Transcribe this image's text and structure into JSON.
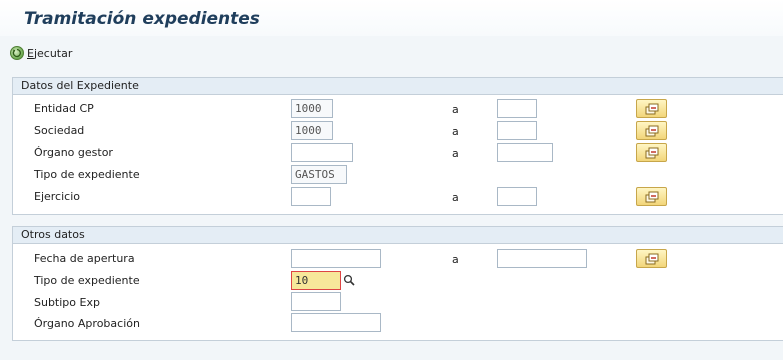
{
  "header": {
    "title": "Tramitación expedientes"
  },
  "toolbar": {
    "execute_label_first": "E",
    "execute_label_rest": "jecutar"
  },
  "group1": {
    "title": "Datos del Expediente",
    "rows": [
      {
        "label": "Entidad CP",
        "low_value": "1000",
        "range_label": "a",
        "high_value": ""
      },
      {
        "label": "Sociedad",
        "low_value": "1000",
        "range_label": "a",
        "high_value": ""
      },
      {
        "label": "Órgano gestor",
        "low_value": "",
        "range_label": "a",
        "high_value": ""
      },
      {
        "label": "Tipo de expediente",
        "low_value": "GASTOS"
      },
      {
        "label": "Ejercicio",
        "low_value": "",
        "range_label": "a",
        "high_value": ""
      }
    ]
  },
  "group2": {
    "title": "Otros datos",
    "rows": [
      {
        "label": "Fecha de apertura",
        "low_value": "",
        "range_label": "a",
        "high_value": ""
      },
      {
        "label": "Tipo de expediente",
        "low_value": "10"
      },
      {
        "label": "Subtipo Exp",
        "low_value": ""
      },
      {
        "label": "Órgano Aprobación",
        "low_value": ""
      }
    ]
  },
  "icons": {
    "execute": "execute-icon",
    "multiple_selection": "multiple-selection-icon",
    "value_help": "search-help-icon"
  },
  "colors": {
    "title": "#1f3e5c",
    "group_header_bg": "#e4edf5",
    "multi_button": "#f2d57a",
    "active_field": "#f7e79a"
  }
}
